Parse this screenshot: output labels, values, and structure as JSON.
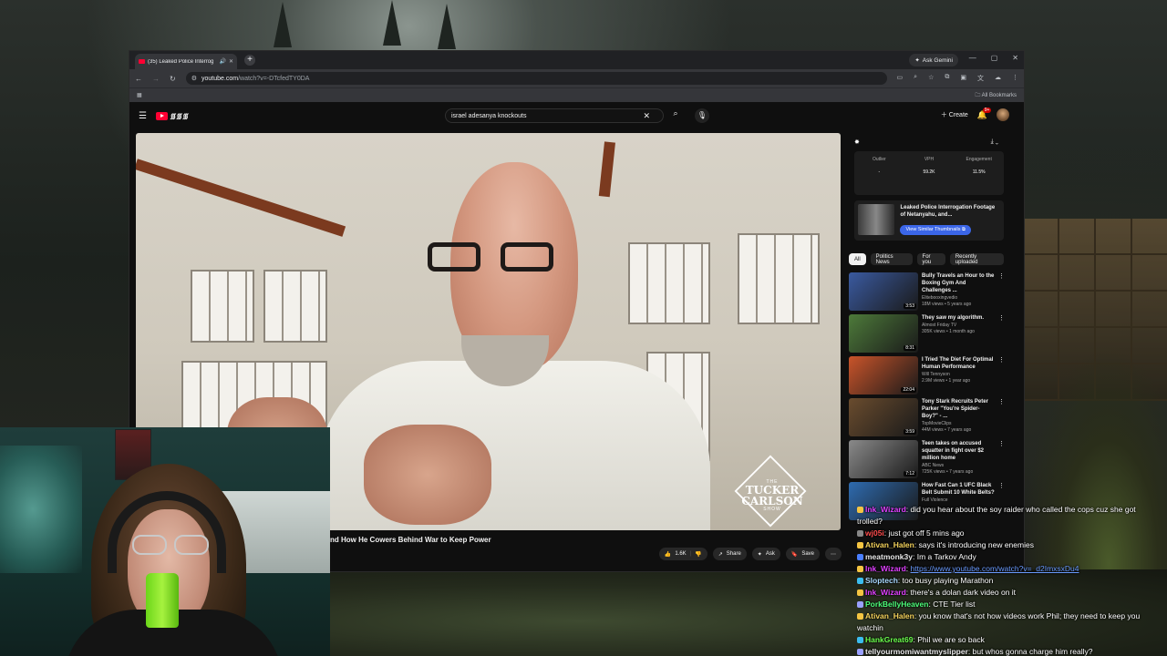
{
  "browser": {
    "tab_title": "(35) Leaked Police Interrog",
    "url_host": "youtube.com",
    "url_path": "/watch?v=-DTcfedTY0DA",
    "gemini_label": "Ask Gemini",
    "bookmarks_label": "All Bookmarks"
  },
  "youtube": {
    "search_query": "israel adesanya knockouts",
    "create_label": "Create",
    "notif_count": "9+",
    "video_title": "nd How He Cowers Behind War to Keep Power",
    "watermark_line1": "THE",
    "watermark_line2": "TUCKER",
    "watermark_line3": "CARLSON",
    "watermark_line4": "SHOW",
    "actions": {
      "likes": "1.6K",
      "share": "Share",
      "ask": "Ask",
      "save": "Save"
    }
  },
  "extension": {
    "stats": [
      {
        "label": "Outlier",
        "value": "-"
      },
      {
        "label": "VPH",
        "value": "59.2K"
      },
      {
        "label": "Engagement",
        "value": "11.5%"
      }
    ],
    "card_title": "Leaked Police Interrogation Footage of Netanyahu, and...",
    "card_button": "View Similar Thumbnails"
  },
  "chips": [
    "All",
    "Politics News",
    "For you",
    "Recently uploaded"
  ],
  "related": [
    {
      "title": "Bully Travels an Hour to the Boxing Gym And Challenges ...",
      "channel": "Elitebooxingvedio",
      "views": "18M views • 5 years ago",
      "duration": "3:53",
      "color": "#3a5aa0"
    },
    {
      "title": "They saw my algorithm.",
      "channel": "Almost Friday TV",
      "views": "305K views • 1 month ago",
      "duration": "8:31",
      "color": "#4d7a3a"
    },
    {
      "title": "I Tried The Diet For Optimal Human Performance",
      "channel": "Will Tennyson",
      "views": "2.9M views • 1 year ago",
      "duration": "22:04",
      "color": "#c9542a"
    },
    {
      "title": "Tony Stark Recruits Peter Parker \"You're Spider-Boy?\" - ...",
      "channel": "TopMovieClips",
      "views": "44M views • 7 years ago",
      "duration": "3:59",
      "color": "#6a4c2e"
    },
    {
      "title": "Teen takes on accused squatter in fight over $2 million home",
      "channel": "ABC News",
      "views": "725K views • 7 years ago",
      "duration": "7:12",
      "color": "#8a8a8a"
    },
    {
      "title": "How Fast Can 1 UFC Black Belt Submit 10 White Belts?",
      "channel": "Full Violence",
      "views": "",
      "duration": "",
      "color": "#2e6bb0"
    }
  ],
  "chat": [
    {
      "user": "Ink_Wizard",
      "text": "did you hear about the soy raider who called the cops cuz she got trolled?",
      "color": "#e040ff",
      "badge": "#f5c542"
    },
    {
      "user": "wj05i",
      "text": "just got off 5 mins ago",
      "color": "#ff4d4d",
      "badge": "#888888"
    },
    {
      "user": "Ativan_Halen",
      "text": "says it's introducing new enemies",
      "color": "#f5d35c",
      "badge": "#f5c542"
    },
    {
      "user": "meatmonk3y",
      "text": "Im a Tarkov Andy",
      "color": "#e8e8e8",
      "badge": "#4a7fff"
    },
    {
      "user": "Ink_Wizard",
      "text": "https://www.youtube.com/watch?v=_d2ImxsxDu4",
      "color": "#e040ff",
      "badge": "#f5c542",
      "link": true
    },
    {
      "user": "Sloptech",
      "text": "too busy playing Marathon",
      "color": "#a8d8ff",
      "badge": "#3bbdf0"
    },
    {
      "user": "Ink_Wizard",
      "text": "there's a dolan dark video on it",
      "color": "#e040ff",
      "badge": "#f5c542"
    },
    {
      "user": "PorkBellyHeaven",
      "text": "CTE Tier list",
      "color": "#4dff7a",
      "badge": "#9aa0ff"
    },
    {
      "user": "Ativan_Halen",
      "text": "you know that's not how videos work Phil; they need to keep you watchin",
      "color": "#f5d35c",
      "badge": "#f5c542"
    },
    {
      "user": "HankGreat69",
      "text": "Phil we are so back",
      "color": "#6bff4d",
      "badge": "#3bbdf0"
    },
    {
      "user": "tellyourmomiwantmyslipper",
      "text": "but whos gonna charge him really?",
      "color": "#e8e8e8",
      "badge": "#9aa0ff"
    }
  ]
}
